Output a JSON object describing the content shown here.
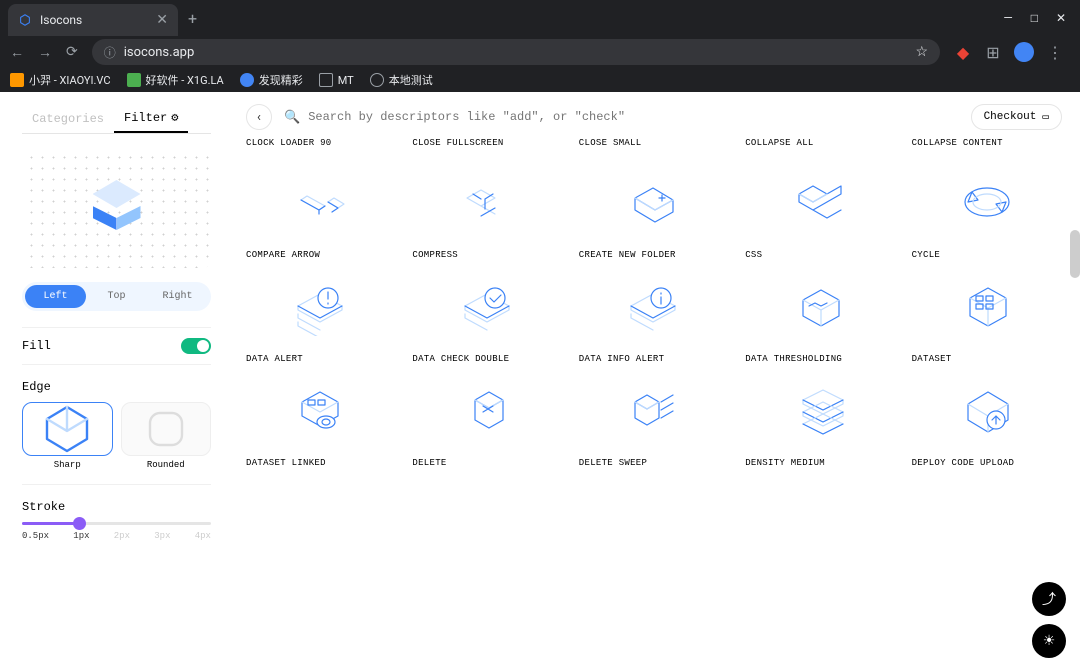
{
  "browser": {
    "tab_title": "Isocons",
    "url": "isocons.app",
    "window": {
      "min": "—",
      "max": "□",
      "close": "✕"
    },
    "bookmarks": [
      {
        "label": "小羿 - XIAOYI.VC",
        "color": "#ff9800"
      },
      {
        "label": "好软件 - X1G.LA",
        "color": "#4caf50"
      },
      {
        "label": "发现精彩",
        "color": "#4285f4"
      },
      {
        "label": "MT",
        "color": "#9aa0a6"
      },
      {
        "label": "本地测试",
        "color": "#9aa0a6"
      }
    ]
  },
  "sidebar": {
    "tabs": {
      "categories": "Categories",
      "filter": "Filter"
    },
    "orientation": {
      "left": "Left",
      "top": "Top",
      "right": "Right"
    },
    "fill_label": "Fill",
    "edge_label": "Edge",
    "edge_opts": {
      "sharp": "Sharp",
      "rounded": "Rounded"
    },
    "stroke_label": "Stroke",
    "stroke_ticks": [
      "0.5px",
      "1px",
      "2px",
      "3px",
      "4px"
    ]
  },
  "search": {
    "placeholder": "Search by descriptors like \"add\", or \"check\""
  },
  "checkout_label": "Checkout",
  "top_row_names": [
    "CLOCK LOADER 90",
    "CLOSE FULLSCREEN",
    "CLOSE SMALL",
    "COLLAPSE ALL",
    "COLLAPSE CONTENT"
  ],
  "rows": [
    [
      "COMPARE ARROW",
      "COMPRESS",
      "CREATE NEW FOLDER",
      "CSS",
      "CYCLE"
    ],
    [
      "DATA ALERT",
      "DATA CHECK DOUBLE",
      "DATA INFO ALERT",
      "DATA THRESHOLDING",
      "DATASET"
    ],
    [
      "DATASET LINKED",
      "DELETE",
      "DELETE SWEEP",
      "DENSITY MEDIUM",
      "DEPLOY CODE UPLOAD"
    ]
  ]
}
